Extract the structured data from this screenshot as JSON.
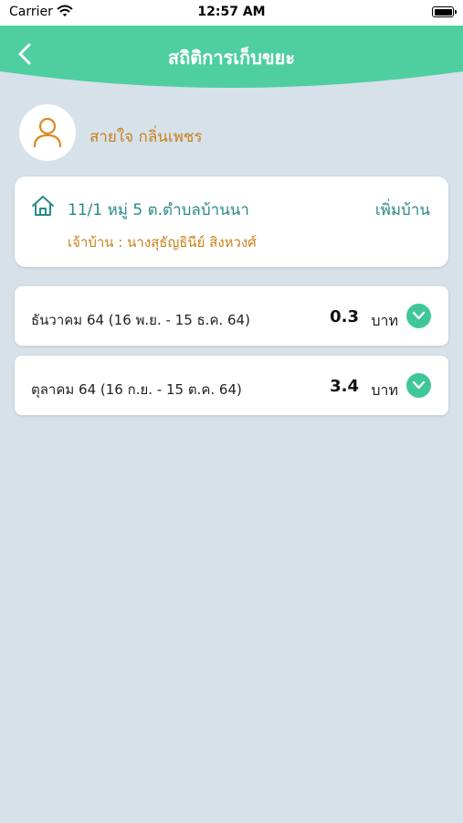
{
  "status_bar": {
    "carrier": "Carrier",
    "time": "12:57 AM"
  },
  "header": {
    "title": "สถิติการเก็บขยะ",
    "color": "#4fcfa0"
  },
  "profile": {
    "name": "สายใจ กลิ่นเพชร",
    "icon": "user-icon"
  },
  "house": {
    "address": "11/1 หมู่ 5 ต.ตำบลบ้านนา",
    "add_label": "เพิ่มบ้าน",
    "owner": "เจ้าบ้าน : นางสุธัญธินีย์ สิงหวงศ์",
    "icon": "home-icon"
  },
  "months": [
    {
      "label": "ธันวาคม 64 (16 พ.ย. - 15 ธ.ค. 64)",
      "amount": "0.3",
      "unit": "บาท"
    },
    {
      "label": "ตุลาคม 64 (16 ก.ย. - 15 ต.ค. 64)",
      "amount": "3.4",
      "unit": "บาท"
    }
  ],
  "colors": {
    "accent": "#3fc79a",
    "teal_text": "#2a8a8a",
    "orange_text": "#c8821a",
    "background": "#d7e1ea"
  }
}
